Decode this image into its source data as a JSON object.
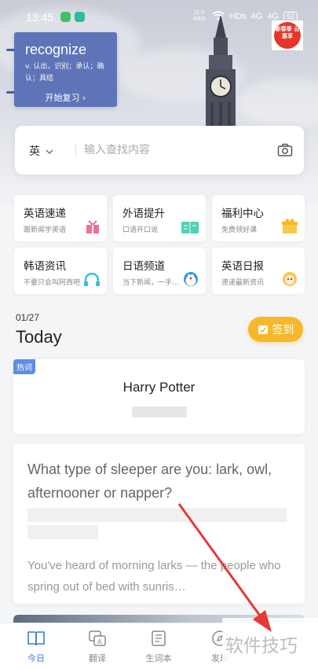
{
  "status_bar": {
    "time": "13:45",
    "speed": "12.0 KB/S",
    "network": "HDs",
    "signal1": "4G",
    "signal2": "4G",
    "battery": "52"
  },
  "promo_badge": {
    "text": "新春季 云惠享"
  },
  "word_card": {
    "word": "recognize",
    "definition": "v. 认出，识别；承认；确认；具结",
    "review_label": "开始复习 ›"
  },
  "search": {
    "language": "英",
    "placeholder": "输入查找内容"
  },
  "features": [
    {
      "title": "英语速递",
      "subtitle": "跟新闻学英语",
      "icon": "gift-icon"
    },
    {
      "title": "外语提升",
      "subtitle": "口语开口说",
      "icon": "book-icon"
    },
    {
      "title": "福利中心",
      "subtitle": "免费领好课",
      "icon": "giftbox-icon"
    },
    {
      "title": "韩语资讯",
      "subtitle": "不要只会叫阿西吧",
      "icon": "headphone-icon"
    },
    {
      "title": "日语频道",
      "subtitle": "当下新闻，一手…",
      "icon": "doraemon-icon"
    },
    {
      "title": "英语日报",
      "subtitle": "速递最新资讯",
      "icon": "avatar-icon"
    }
  ],
  "daily": {
    "date": "01/27",
    "heading": "Today",
    "checkin_label": "签到"
  },
  "hot_word": {
    "tag": "热词",
    "title": "Harry Potter"
  },
  "article": {
    "title": "What type of sleeper are you: lark, owl, afternooner or napper?",
    "excerpt": "You've heard of morning larks — the people who spring out of bed with sunris…"
  },
  "tabs": [
    {
      "label": "今日",
      "icon": "book-open-icon",
      "active": true
    },
    {
      "label": "翻译",
      "icon": "translate-icon",
      "active": false
    },
    {
      "label": "生词本",
      "icon": "notebook-icon",
      "active": false
    },
    {
      "label": "发现",
      "icon": "discover-icon",
      "active": false
    }
  ],
  "watermark": "软件技巧",
  "colors": {
    "accent": "#3a7bd5",
    "checkin": "#f6b82a",
    "word_card": "#5f74b8",
    "annotation_arrow": "#e53935"
  }
}
